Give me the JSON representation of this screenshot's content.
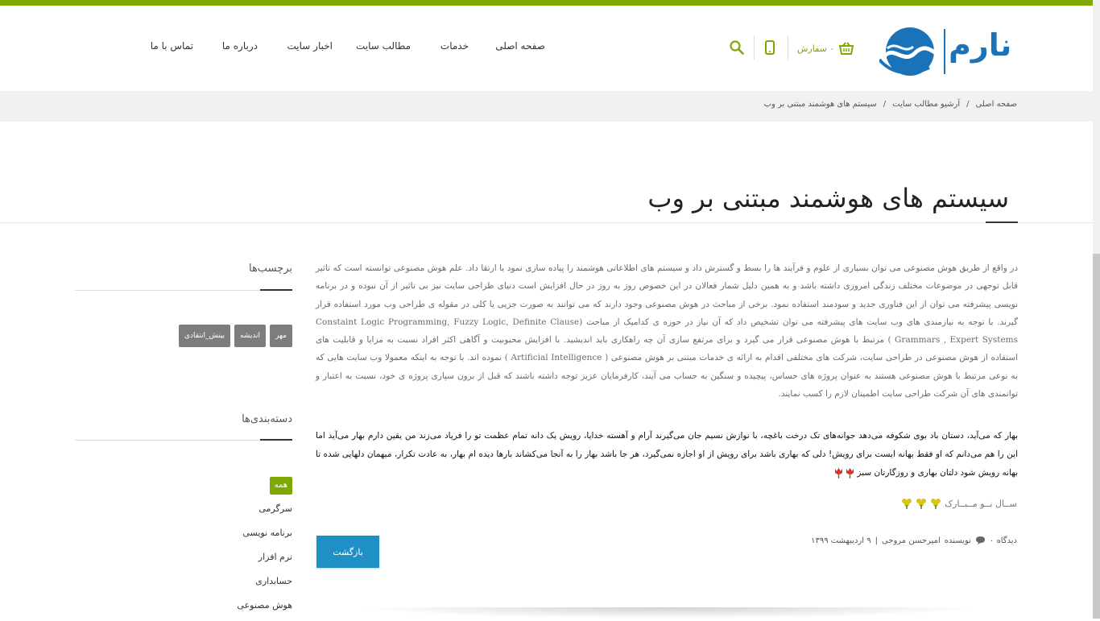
{
  "colors": {
    "accent": "#7ea802",
    "brand": "#1a73b8",
    "button": "#1e90c6",
    "tag": "#7d7d7d"
  },
  "header": {
    "logo_text": "نارم",
    "cart_label": "۰ سفارش",
    "cart_icon": "basket-icon",
    "mobile_icon": "mobile-icon",
    "search_icon": "search-icon"
  },
  "nav": {
    "items": [
      {
        "label": "صفحه اصلی"
      },
      {
        "label": "خدمات"
      },
      {
        "label": "مطالب سایت"
      },
      {
        "label": "اخبار سایت"
      },
      {
        "label": "درباره ما"
      },
      {
        "label": "تماس با ما"
      }
    ]
  },
  "breadcrumb": {
    "items": [
      "صفحه اصلی",
      "آرشیو مطالب سایت",
      "سیستم های هوشمند مبتنی بر وب"
    ],
    "separator": "/"
  },
  "post": {
    "title": "سیستم های هوشمند مبتنی بر وب",
    "body": "در واقع از طریق هوش مصنوعی می توان بسیاری از علوم و فرآیند ها را بسط و گسترش داد و سیستم های اطلاعاتی هوشمند را پیاده سازی نمود یا ارتقا داد. علم هوش مصنوعی توانسته است که تاثیر قابل توجهی در موضوعات مختلف زندگی امروزی داشته باشد و به همین دلیل شمار فعالان در این خصوص روز به روز در حال افزایش است دنیای طراحی سایت نیز بی تاثیر از آن نبوده و در برنامه نویسی پیشرفته می توان از این فناوری جدید و سودمند استفاده نمود. برخی از مباحث در هوش مصنوعی وجود دارند که می توانند به صورت جزیی یا کلی در مقوله ی طراحی وب مورد استفاده قرار گیرند. با توجه به نیازمندی های وب سایت های پیشرفته می توان تشخیص داد که آن نیاز در حوزه ی کدامیک از مباحث (Constaint Logic Programming, Fuzzy Logic, Definite Clause Grammars , Expert Systems ) مرتبط با هوش مصنوعی قرار می گیرد و برای مرتفع سازی آن چه راهکاری باید اندیشید. با افزایش محبوبیت و آگاهی اکثر افراد نسبت به مزایا و قابلیت های استفاده از هوش مصنوعی در طراحی سایت، شرکت های مختلفی اقدام به ارائه ی خدمات مبتنی بر هوش مصنوعی ( Artificial Intelligence ) نموده اند. با توجه به اینکه معمولا وب سایت هایی که به نوعی مرتبط با هوش مصنوعی هستند به عنوان پروژه های حساس، پیچیده و سنگین به حساب می آیند، کارفرمایان عزیز توجه داشته باشند که قبل از برون سپاری پروژه ی خود، نسبت به اعتبار و توانمندی های آن شرکت طراحی سایت اطمینان لازم را کسب نمایند.",
    "poem": "بهار که می‌آید، دستان باد بوی شکوفه می‌دهد جوانه‌های تک درخت باغچه، با نوازش نسیم جان می‌گیرند آرام و آهسته خدایا، رویش یک دانه تمام عظمت تو را فریاد می‌زند من یقین دارم بهار می‌آید اما این را هم می‌دانم که او فقط بهانه ایست برای رویش! دلی که بهاری باشد برای رویش از او اجازه نمی‌گیرد، هر جا باشد بهار را به آنجا می‌کشاند بارها دیده ام بهار، به عادت تکرار، میهمان دلهایی شده تا بهانه رویش شود دلتان بهاری و روزگارتان سبز",
    "greeting": "ســال نــو مــبــارک",
    "meta": {
      "views_label": "دیدگاه ۰",
      "author_label": "نویسنده",
      "author": "امیرحسن مروجی",
      "date": "۹ اردیبهشت ۱۳۹۹"
    },
    "back_label": "بازگشت"
  },
  "sidebar": {
    "tags_title": "برچسب‌ها",
    "tags": [
      "مهر",
      "اندیشه",
      "بینش_انتقادی"
    ],
    "categories_title": "دسته‌بندی‌ها",
    "categories": [
      "همه",
      "سرگرمی",
      "برنامه نویسی",
      "نرم افزار",
      "حسابداری",
      "هوش مصنوعی"
    ]
  }
}
